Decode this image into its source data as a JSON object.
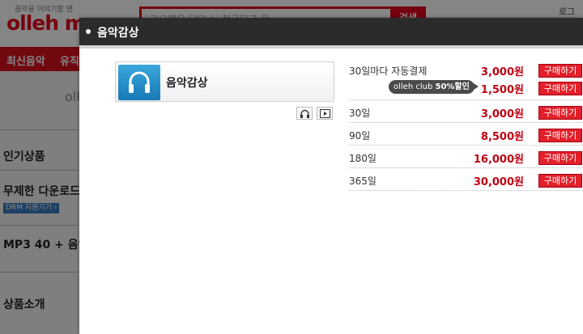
{
  "background": {
    "slogan": "음악을 이야기할 땐",
    "logo": "olleh m",
    "search_placeholder": "가요팬은 당만 뉴 첫궁다고 묻",
    "search_button": "검색",
    "top_right": "로그",
    "nav_items": [
      "최신음악",
      "유직"
    ],
    "watermark": "oll",
    "sidebar": {
      "popular": "인기상품",
      "unlimited": "무제한 다운로드",
      "drm_badge": "DRM 지원기기 ›",
      "mp3": "MP3 40 + 음익",
      "intro": "상품소개"
    }
  },
  "modal": {
    "title": "음악감상",
    "product": {
      "name": "음악감상",
      "icon": "headphones-icon"
    },
    "mini_buttons": [
      "headphones-icon",
      "video-icon"
    ],
    "rows": [
      {
        "period": "30일마다 자동결제",
        "price": "3,000원",
        "buy_label": "구매하기"
      },
      {
        "club_tag_prefix": "olleh club ",
        "club_tag_bold": "50%할인",
        "price": "1,500원",
        "buy_label": "구매하기"
      },
      {
        "period": "30일",
        "price": "3,000원",
        "buy_label": "구매하기"
      },
      {
        "period": "90일",
        "price": "8,500원",
        "buy_label": "구매하기"
      },
      {
        "period": "180일",
        "price": "16,000원",
        "buy_label": "구매하기"
      },
      {
        "period": "365일",
        "price": "30,000원",
        "buy_label": "구매하기"
      }
    ]
  },
  "colors": {
    "brand_red": "#e2001a",
    "price_red": "#c00012",
    "header_dark": "#2b2b2b"
  }
}
